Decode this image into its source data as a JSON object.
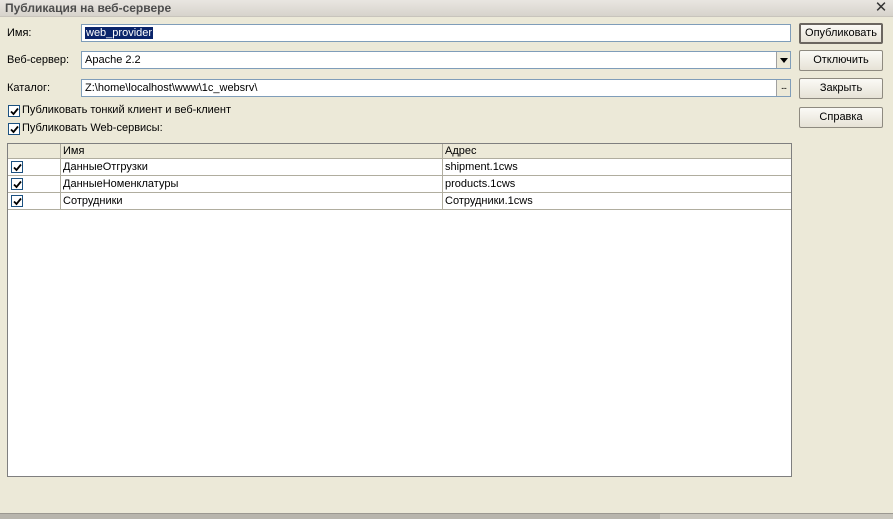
{
  "window": {
    "title": "Публикация на веб-сервере",
    "close_icon": "close-icon"
  },
  "form": {
    "name_label": "Имя:",
    "name_value": "web_provider",
    "server_label": "Веб-сервер:",
    "server_value": "Apache 2.2",
    "catalog_label": "Каталог:",
    "catalog_value": "Z:\\home\\localhost\\www\\1c_websrv\\",
    "catalog_browse": "...",
    "publish_thin_client_label": "Публиковать тонкий клиент и веб-клиент",
    "publish_thin_client_checked": true,
    "publish_web_services_label": "Публиковать Web-сервисы:",
    "publish_web_services_checked": true
  },
  "buttons": {
    "publish": "Опубликовать",
    "disable": "Отключить",
    "close": "Закрыть",
    "help": "Справка"
  },
  "services_table": {
    "columns": [
      "",
      "Имя",
      "Адрес"
    ],
    "rows": [
      {
        "checked": true,
        "name": "ДанныеОтгрузки",
        "address": "shipment.1cws"
      },
      {
        "checked": true,
        "name": "ДанныеНоменклатуры",
        "address": "products.1cws"
      },
      {
        "checked": true,
        "name": "Сотрудники",
        "address": "Сотрудники.1cws"
      }
    ]
  }
}
